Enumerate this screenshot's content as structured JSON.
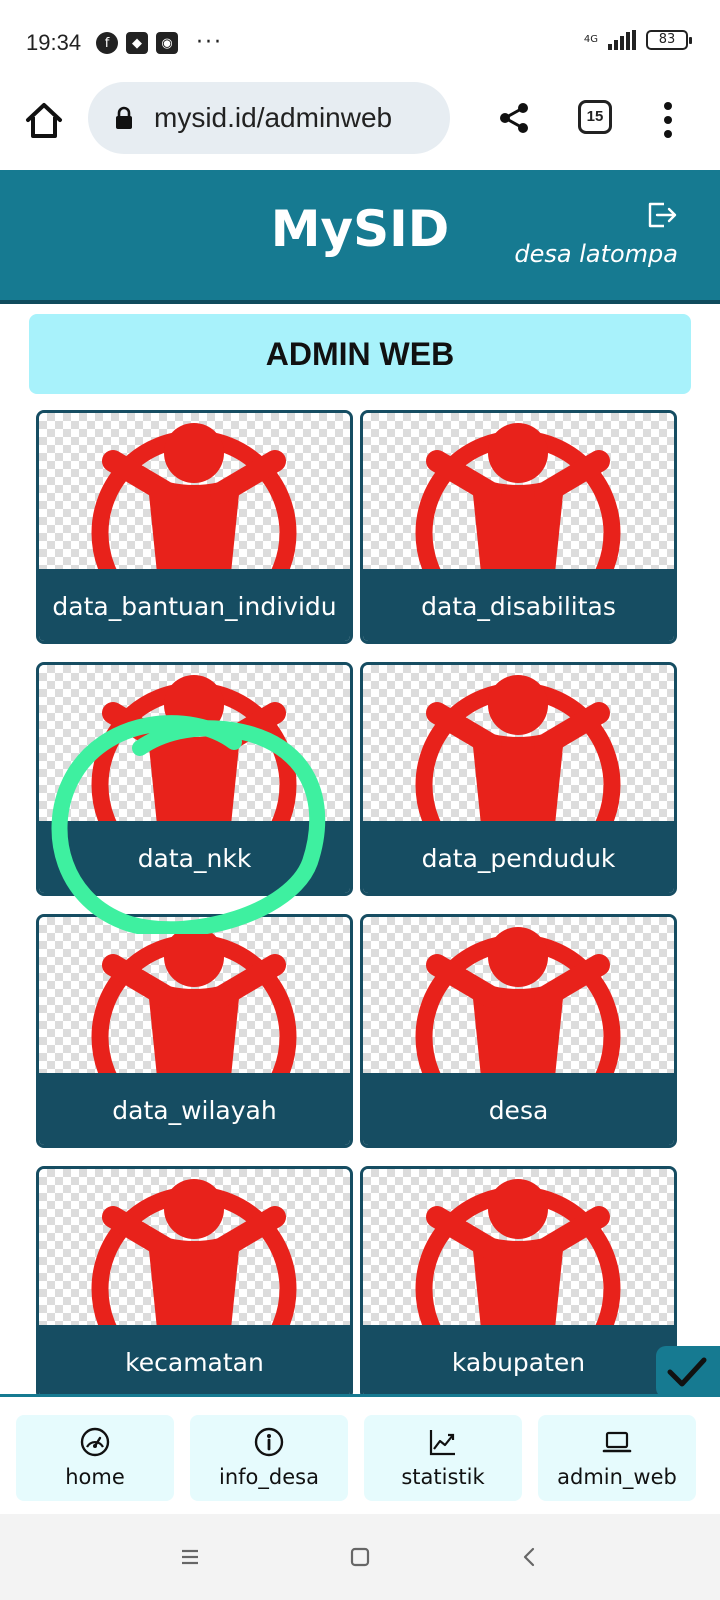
{
  "status_bar": {
    "time": "19:34",
    "network_label": "4G",
    "battery_level": "83",
    "notification_icons": [
      "facebook-icon",
      "maps-icon",
      "bike-icon"
    ],
    "more_label": "···"
  },
  "browser": {
    "url": "mysid.id/adminweb",
    "tab_count": "15"
  },
  "app": {
    "title": "MySID",
    "village": "desa latompa",
    "accent_color": "#167a91",
    "dark_color": "#164d62"
  },
  "admin_banner": "ADMIN WEB",
  "menu_items": [
    {
      "label": "data_bantuan_individu"
    },
    {
      "label": "data_disabilitas"
    },
    {
      "label": "data_nkk"
    },
    {
      "label": "data_penduduk"
    },
    {
      "label": "data_wilayah"
    },
    {
      "label": "desa"
    },
    {
      "label": "kecamatan"
    },
    {
      "label": "kabupaten"
    }
  ],
  "bottom_nav": [
    {
      "label": "home",
      "icon": "dashboard-gauge-icon"
    },
    {
      "label": "info_desa",
      "icon": "info-circle-icon"
    },
    {
      "label": "statistik",
      "icon": "chart-line-icon"
    },
    {
      "label": "admin_web",
      "icon": "laptop-icon"
    }
  ]
}
